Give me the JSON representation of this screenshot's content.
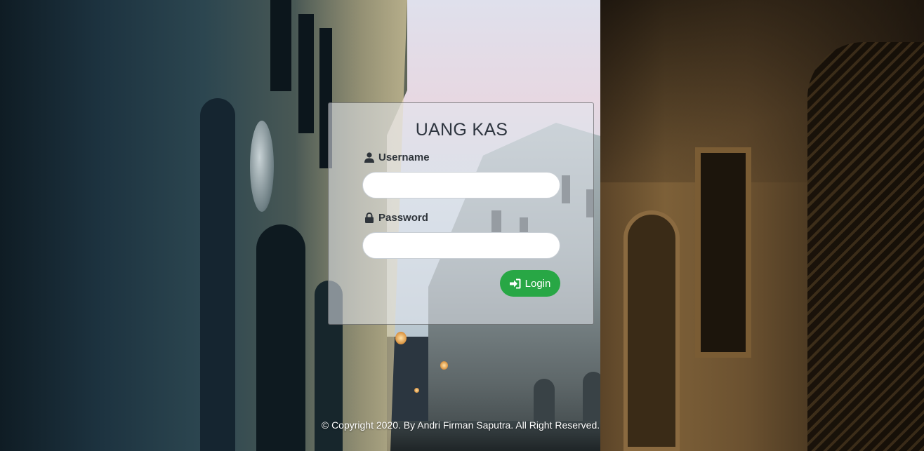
{
  "login": {
    "title": "UANG KAS",
    "username_label": "Username",
    "username_icon": "user-icon",
    "username_value": "",
    "password_label": "Password",
    "password_icon": "lock-icon",
    "password_value": "",
    "button_label": "Login",
    "button_icon": "sign-in-icon",
    "button_color": "#28a745"
  },
  "footer": {
    "text": "© Copyright 2020. By Andri Firman Saputra. All Right Reserved."
  }
}
